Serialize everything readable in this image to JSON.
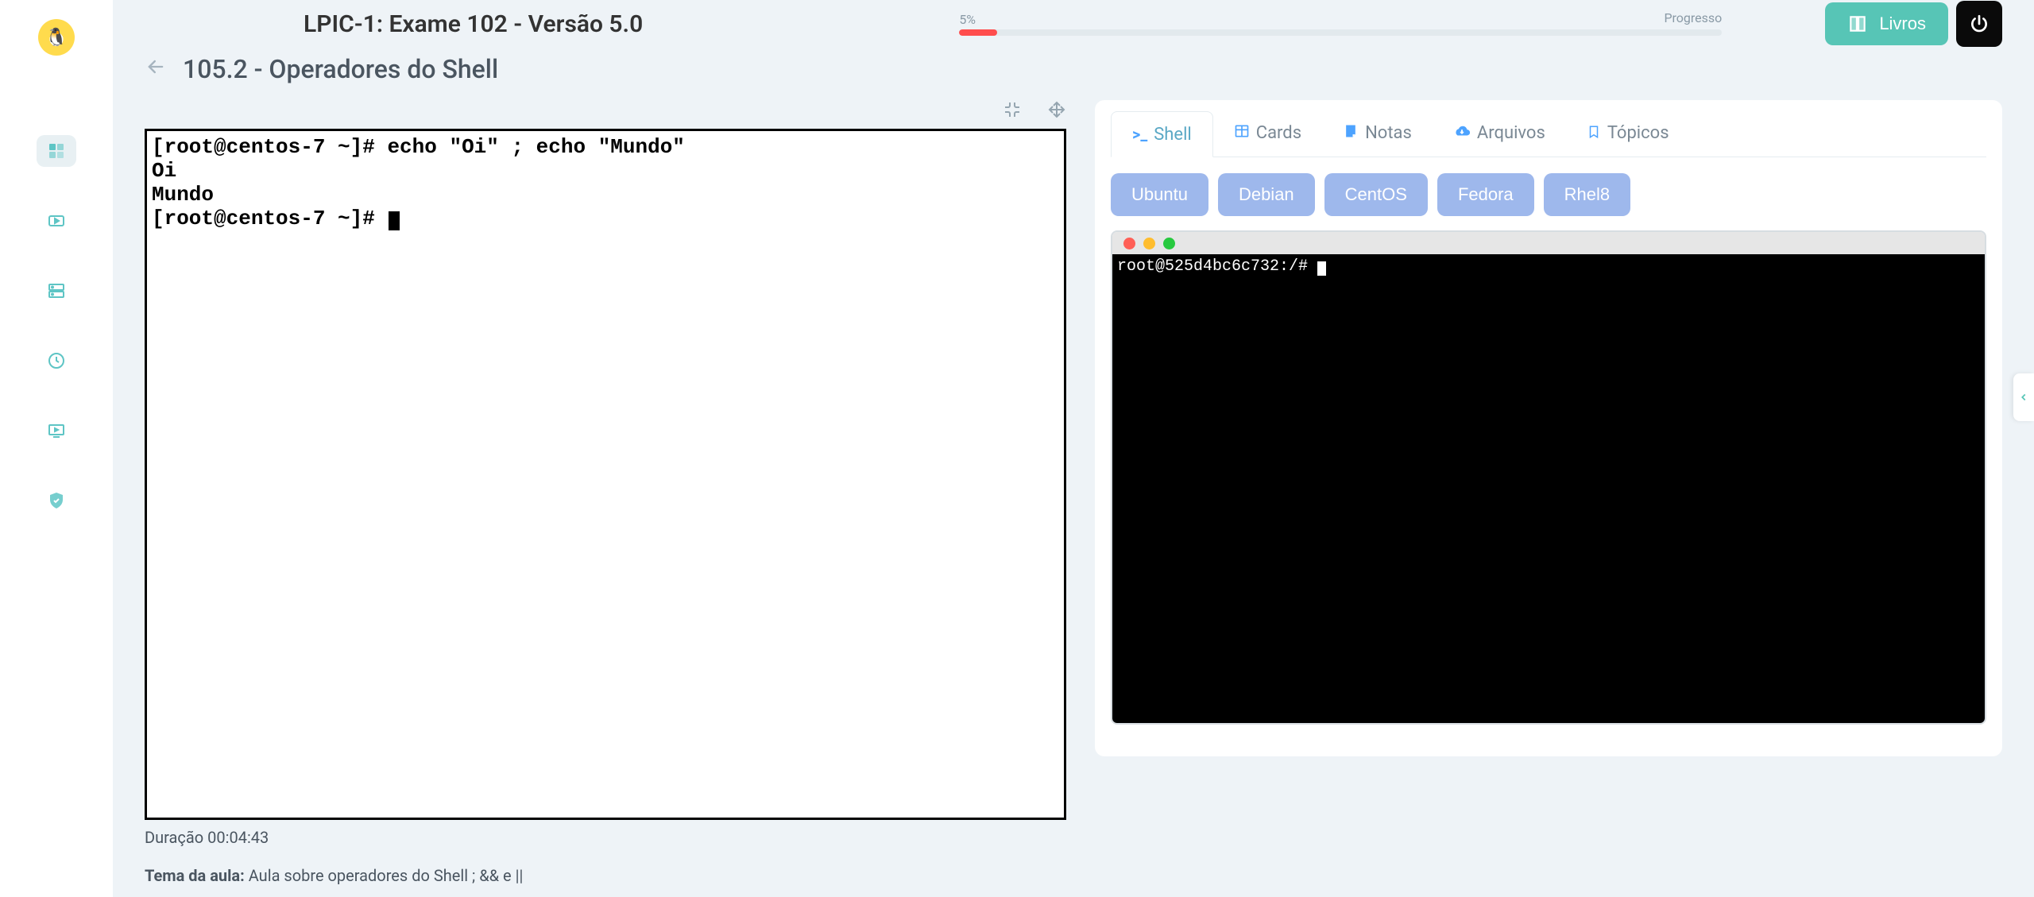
{
  "course_title": "LPIC-1: Exame 102 - Versão 5.0",
  "lesson_title": "105.2 - Operadores do Shell",
  "progress": {
    "pct_text": "5%",
    "label": "Progresso",
    "fill_pct": 5
  },
  "top_actions": {
    "livros": "Livros"
  },
  "video": {
    "terminal_lines": "[root@centos-7 ~]# echo \"Oi\" ; echo \"Mundo\"\nOi\nMundo\n[root@centos-7 ~]# ",
    "duration_label": "Duração",
    "duration_value": "00:04:43",
    "tema_label": "Tema da aula:",
    "tema_text": "Aula sobre operadores do Shell ; && e ||"
  },
  "panel": {
    "tabs": [
      {
        "label": "Shell",
        "icon": ">_"
      },
      {
        "label": "Cards",
        "icon": "▦"
      },
      {
        "label": "Notas",
        "icon": "■"
      },
      {
        "label": "Arquivos",
        "icon": "☁"
      },
      {
        "label": "Tópicos",
        "icon": "☐"
      }
    ],
    "distros": [
      "Ubuntu",
      "Debian",
      "CentOS",
      "Fedora",
      "Rhel8"
    ],
    "terminal_prompt": "root@525d4bc6c732:/# "
  }
}
